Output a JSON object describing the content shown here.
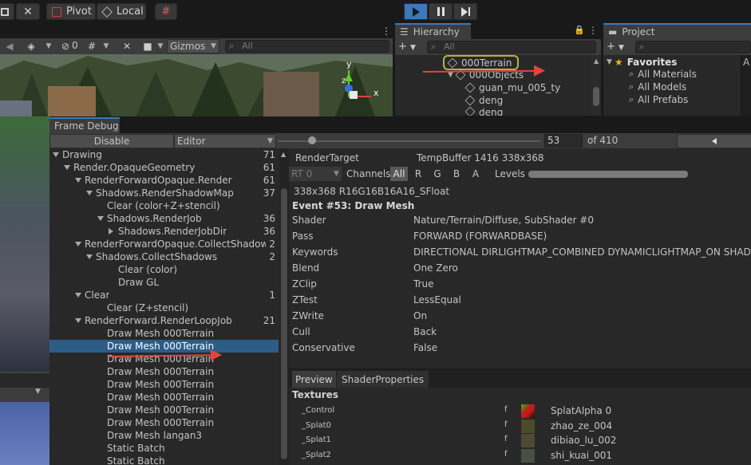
{
  "toolbar": {
    "pivot_label": "Pivot",
    "local_label": "Local"
  },
  "scene": {
    "gizmos_label": "Gizmos",
    "search_placeholder": "All",
    "visibility_count": "0",
    "gizmo_axes": {
      "y": "y",
      "x": "x",
      "z": "z"
    }
  },
  "hierarchy": {
    "tab_label": "Hierarchy",
    "search_placeholder": "All",
    "rows": [
      {
        "label": "000Terrain",
        "highlighted": true
      },
      {
        "label": "000Objects"
      },
      {
        "label": "guan_mu_005_ty"
      },
      {
        "label": "deng"
      },
      {
        "label": "deng"
      }
    ]
  },
  "project": {
    "tab_label": "Project",
    "favorites_label": "Favorites",
    "items": [
      {
        "label": "All Materials"
      },
      {
        "label": "All Models"
      },
      {
        "label": "All Prefabs"
      }
    ]
  },
  "frame_debug": {
    "tab_label": "Frame Debug",
    "disable_label": "Disable",
    "target_label": "Editor",
    "current_event": "53",
    "total_label": "of 410",
    "slider_fraction": 0.129,
    "tree": [
      {
        "label": "Drawing",
        "count": "71",
        "indent": 0,
        "toggle": "down"
      },
      {
        "label": "Render.OpaqueGeometry",
        "count": "61",
        "indent": 1,
        "toggle": "down"
      },
      {
        "label": "RenderForwardOpaque.Render",
        "count": "61",
        "indent": 2,
        "toggle": "down"
      },
      {
        "label": "Shadows.RenderShadowMap",
        "count": "37",
        "indent": 3,
        "toggle": "down"
      },
      {
        "label": "Clear (color+Z+stencil)",
        "count": "",
        "indent": 4,
        "toggle": ""
      },
      {
        "label": "Shadows.RenderJob",
        "count": "36",
        "indent": 4,
        "toggle": "down"
      },
      {
        "label": "Shadows.RenderJobDir",
        "count": "36",
        "indent": 5,
        "toggle": "right"
      },
      {
        "label": "RenderForwardOpaque.CollectShadows",
        "count": "2",
        "indent": 2,
        "toggle": "down"
      },
      {
        "label": "Shadows.CollectShadows",
        "count": "2",
        "indent": 3,
        "toggle": "down"
      },
      {
        "label": "Clear (color)",
        "count": "",
        "indent": 5,
        "toggle": ""
      },
      {
        "label": "Draw GL",
        "count": "",
        "indent": 5,
        "toggle": ""
      },
      {
        "label": "Clear",
        "count": "1",
        "indent": 2,
        "toggle": "down"
      },
      {
        "label": "Clear (Z+stencil)",
        "count": "",
        "indent": 4,
        "toggle": ""
      },
      {
        "label": "RenderForward.RenderLoopJob",
        "count": "21",
        "indent": 2,
        "toggle": "down"
      },
      {
        "label": "Draw Mesh 000Terrain",
        "count": "",
        "indent": 4,
        "toggle": ""
      },
      {
        "label": "Draw Mesh 000Terrain",
        "count": "",
        "indent": 4,
        "toggle": "",
        "selected": true
      },
      {
        "label": "Draw Mesh 000Terrain",
        "count": "",
        "indent": 4,
        "toggle": ""
      },
      {
        "label": "Draw Mesh 000Terrain",
        "count": "",
        "indent": 4,
        "toggle": ""
      },
      {
        "label": "Draw Mesh 000Terrain",
        "count": "",
        "indent": 4,
        "toggle": ""
      },
      {
        "label": "Draw Mesh 000Terrain",
        "count": "",
        "indent": 4,
        "toggle": ""
      },
      {
        "label": "Draw Mesh 000Terrain",
        "count": "",
        "indent": 4,
        "toggle": ""
      },
      {
        "label": "Draw Mesh 000Terrain",
        "count": "",
        "indent": 4,
        "toggle": ""
      },
      {
        "label": "Draw Mesh langan3",
        "count": "",
        "indent": 4,
        "toggle": ""
      },
      {
        "label": "Static Batch",
        "count": "",
        "indent": 4,
        "toggle": ""
      },
      {
        "label": "Static Batch",
        "count": "",
        "indent": 4,
        "toggle": ""
      }
    ],
    "details": {
      "render_target_key": "RenderTarget",
      "render_target_value": "TempBuffer 1416 338x368",
      "rt_label": "RT 0",
      "channels_label": "Channels",
      "channel_buttons": [
        "All",
        "R",
        "G",
        "B",
        "A"
      ],
      "levels_label": "Levels",
      "format": "338x368 R16G16B16A16_SFloat",
      "event_title": "Event #53: Draw Mesh",
      "props": [
        {
          "key": "Shader",
          "value": "Nature/Terrain/Diffuse, SubShader #0"
        },
        {
          "key": "Pass",
          "value": "FORWARD (FORWARDBASE)"
        },
        {
          "key": "Keywords",
          "value": "DIRECTIONAL DIRLIGHTMAP_COMBINED DYNAMICLIGHTMAP_ON SHADO"
        },
        {
          "key": "Blend",
          "value": "One Zero"
        },
        {
          "key": "ZClip",
          "value": "True"
        },
        {
          "key": "ZTest",
          "value": "LessEqual"
        },
        {
          "key": "ZWrite",
          "value": "On"
        },
        {
          "key": "Cull",
          "value": "Back"
        },
        {
          "key": "Conservative",
          "value": "False"
        }
      ],
      "tabs": [
        "Preview",
        "ShaderProperties"
      ],
      "textures_label": "Textures",
      "textures": [
        {
          "name": "_Control",
          "flag": "f",
          "value": "SplatAlpha 0",
          "color": "#c41a1a"
        },
        {
          "name": "_Splat0",
          "flag": "f",
          "value": "zhao_ze_004",
          "color": "#4a4a2c"
        },
        {
          "name": "_Splat1",
          "flag": "f",
          "value": "dibiao_lu_002",
          "color": "#4c4a34"
        },
        {
          "name": "_Splat2",
          "flag": "f",
          "value": "shi_kuai_001",
          "color": "#4a5040"
        }
      ]
    }
  },
  "colors": {
    "accent_blue": "#3a79bb",
    "selection": "#2c5d87",
    "annotation_red": "#e5443b",
    "favorites_star": "#e6b422"
  }
}
